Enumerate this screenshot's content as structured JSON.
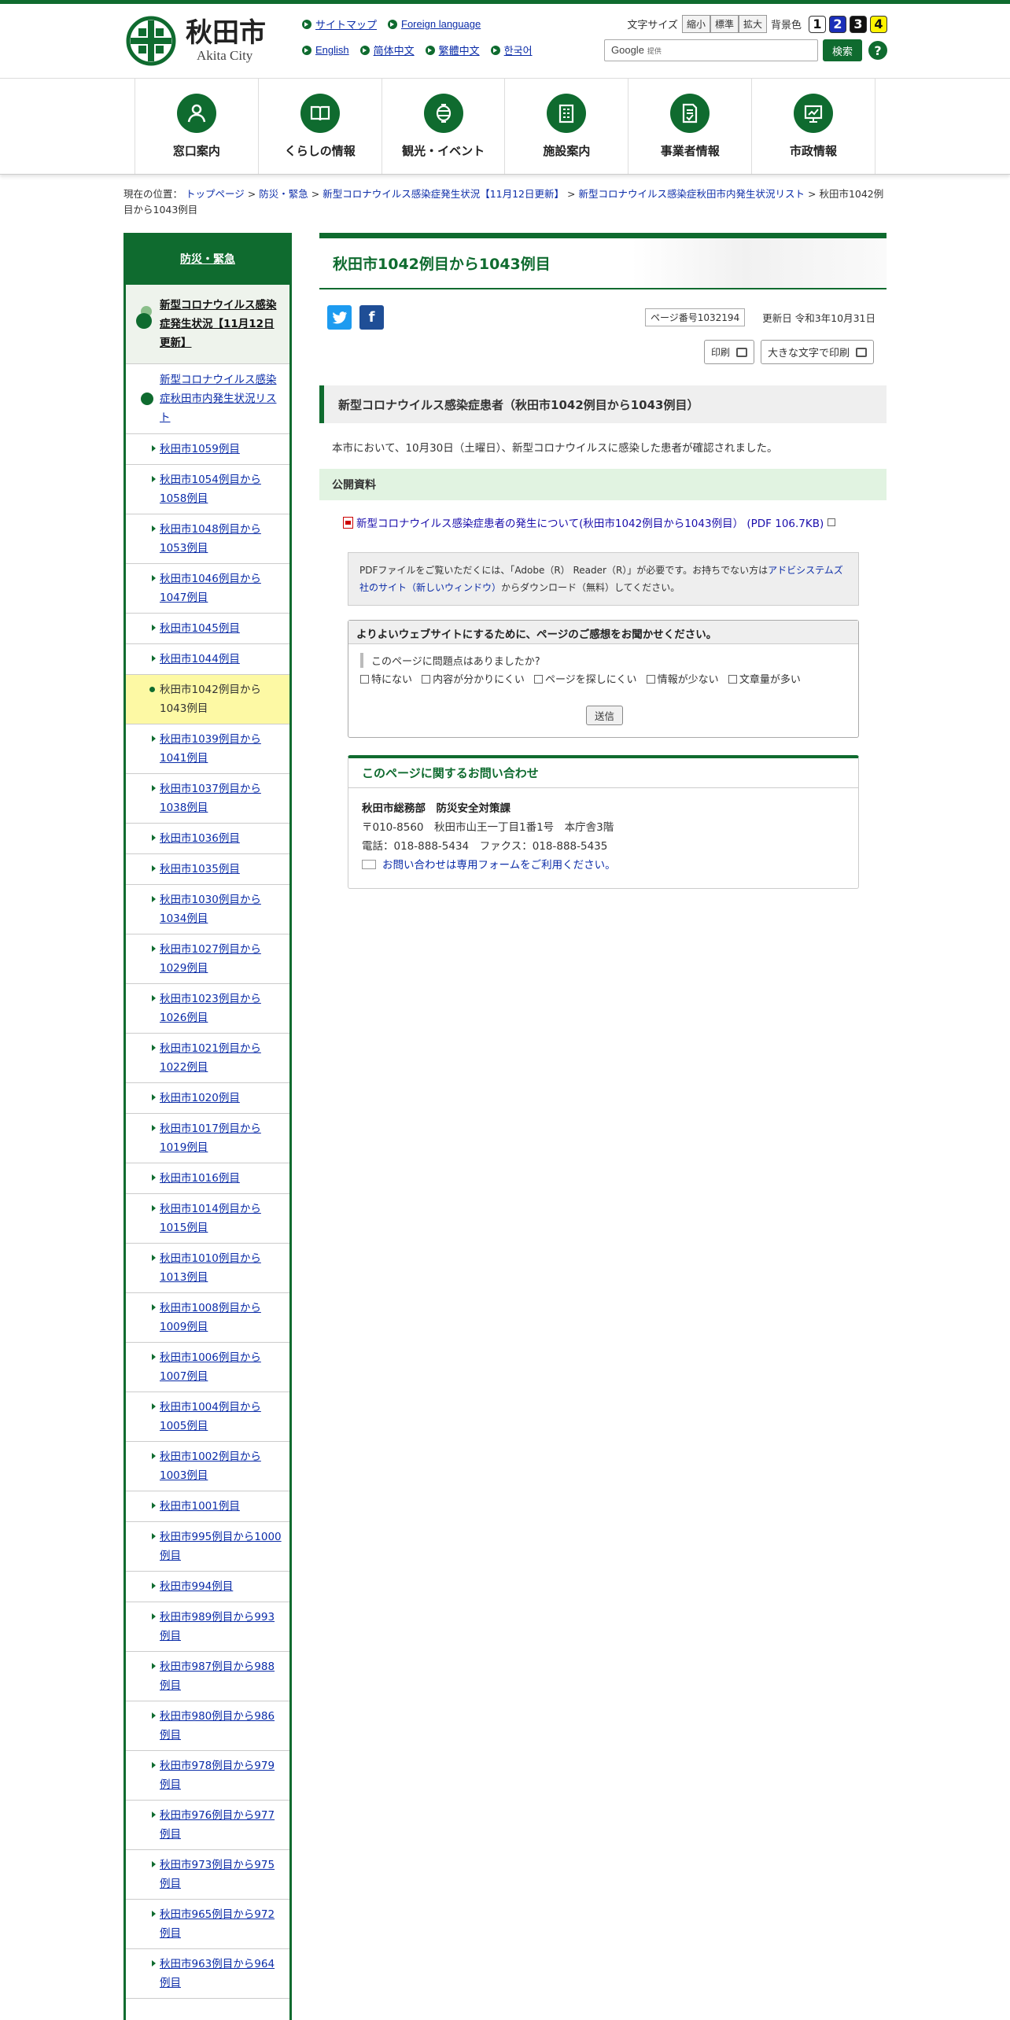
{
  "site": {
    "name_ja": "秋田市",
    "name_en": "Akita City"
  },
  "header_links": {
    "row1": [
      "サイトマップ",
      "Foreign language"
    ],
    "row2": [
      "English",
      "简体中文",
      "繁體中文",
      "한국어"
    ]
  },
  "tools": {
    "font_size_label": "文字サイズ",
    "font_sizes": [
      "縮小",
      "標準",
      "拡大"
    ],
    "bg_label": "背景色",
    "bg_options": [
      "1",
      "2",
      "3",
      "4"
    ]
  },
  "search": {
    "provider": "Google",
    "provided": "提供",
    "button": "検索",
    "help": "?"
  },
  "gnav": [
    "窓口案内",
    "くらしの情報",
    "観光・イベント",
    "施設案内",
    "事業者情報",
    "市政情報"
  ],
  "breadcrumb": {
    "prefix": "現在の位置：",
    "links": [
      "トップページ",
      "防災・緊急",
      "新型コロナウイルス感染症発生状況【11月12日更新】",
      "新型コロナウイルス感染症秋田市内発生状況リスト"
    ],
    "current": "秋田市1042例目から1043例目",
    "sep": ">"
  },
  "sidebar": {
    "head": "防災・緊急",
    "current1": "新型コロナウイルス感染症発生状況【11月12日更新】",
    "current2": "新型コロナウイルス感染症秋田市内発生状況リスト",
    "items": [
      "秋田市1059例目",
      "秋田市1054例目から1058例目",
      "秋田市1048例目から1053例目",
      "秋田市1046例目から1047例目",
      "秋田市1045例目",
      "秋田市1044例目",
      "秋田市1042例目から1043例目",
      "秋田市1039例目から1041例目",
      "秋田市1037例目から1038例目",
      "秋田市1036例目",
      "秋田市1035例目",
      "秋田市1030例目から1034例目",
      "秋田市1027例目から1029例目",
      "秋田市1023例目から1026例目",
      "秋田市1021例目から1022例目",
      "秋田市1020例目",
      "秋田市1017例目から1019例目",
      "秋田市1016例目",
      "秋田市1014例目から1015例目",
      "秋田市1010例目から1013例目",
      "秋田市1008例目から1009例目",
      "秋田市1006例目から1007例目",
      "秋田市1004例目から1005例目",
      "秋田市1002例目から1003例目",
      "秋田市1001例目",
      "秋田市995例目から1000例目",
      "秋田市994例目",
      "秋田市989例目から993例目",
      "秋田市987例目から988例目",
      "秋田市980例目から986例目",
      "秋田市978例目から979例目",
      "秋田市976例目から977例目",
      "秋田市973例目から975例目",
      "秋田市965例目から972例目",
      "秋田市963例目から964例目"
    ]
  },
  "main": {
    "title": "秋田市1042例目から1043例目",
    "page_no": "ページ番号1032194",
    "updated": "更新日 令和3年10月31日",
    "print": "印刷",
    "print_large": "大きな文字で印刷",
    "h2": "新型コロナウイルス感染症患者（秋田市1042例目から1043例目）",
    "lead": "本市において、10月30日（土曜日）、新型コロナウイルスに感染した患者が確認されました。",
    "h3": "公開資料",
    "pdf_link": "新型コロナウイルス感染症患者の発生について(秋田市1042例目から1043例目） (PDF 106.7KB)",
    "adobe_text1": "PDFファイルをご覧いただくには、「Adobe（R） Reader（R）」が必要です。お持ちでない方は",
    "adobe_link": "アドビシステムズ社のサイト（新しいウィンドウ）",
    "adobe_text2": "からダウンロード（無料）してください。",
    "enquete_head": "よりよいウェブサイトにするために、ページのご感想をお聞かせください。",
    "enquete_q": "このページに問題点はありましたか?",
    "enquete_opts": [
      "特にない",
      "内容が分かりにくい",
      "ページを探しにくい",
      "情報が少ない",
      "文章量が多い"
    ],
    "enquete_submit": "送信",
    "contact_head": "このページに関するお問い合わせ",
    "contact_org": "秋田市総務部　防災安全対策課",
    "contact_addr": "〒010-8560　秋田市山王一丁目1番1号　本庁舎3階",
    "contact_tel": "電話：018-888-5434　ファクス：018-888-5435",
    "contact_form": "お問い合わせは専用フォームをご利用ください。"
  },
  "colors": {
    "brand": "#0f6b2f",
    "sidebar_active": "#fdf9a4",
    "link": "#0b2ca8"
  }
}
